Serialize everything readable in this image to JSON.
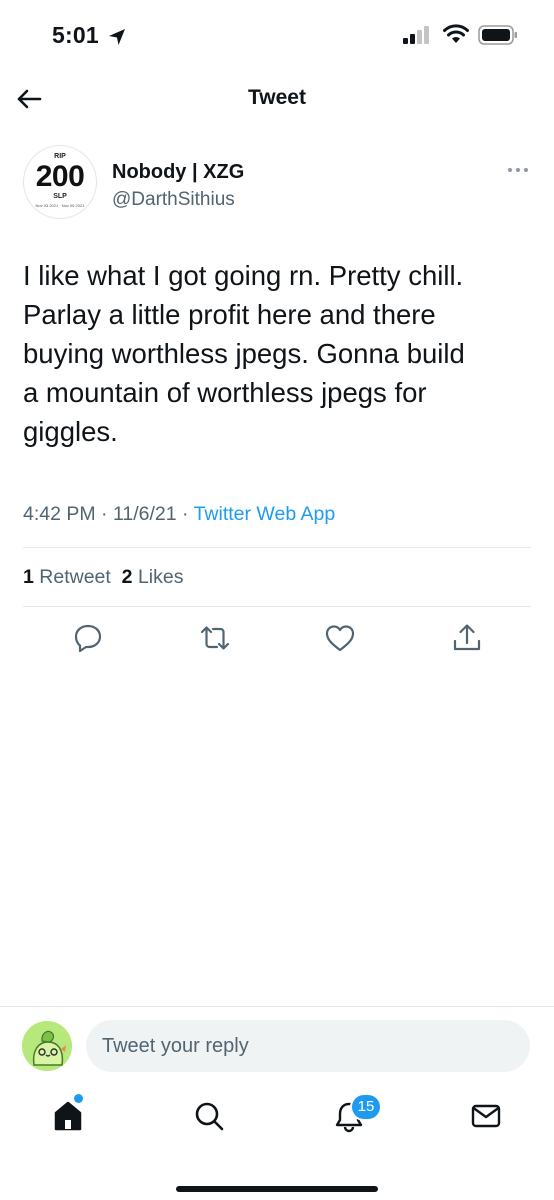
{
  "status_bar": {
    "time": "5:01",
    "location_icon": "location-arrow-icon",
    "signal_icon": "cellular-signal-icon",
    "wifi_icon": "wifi-icon",
    "battery_icon": "battery-icon"
  },
  "header": {
    "title": "Tweet",
    "back_icon": "back-arrow-icon"
  },
  "author": {
    "display_name": "Nobody | XZG",
    "handle": "@DarthSithius",
    "avatar": {
      "top_text": "RIP",
      "number": "200",
      "unit": "SLP",
      "dates": "Nov 03 2021 · Nov 06 2021"
    },
    "more_icon": "more-dots-icon"
  },
  "tweet": {
    "text": "I like what I got going rn. Pretty chill.\nParlay a little profit here and there\nbuying worthless jpegs. Gonna build\na mountain of worthless jpegs for\ngiggles.",
    "time": "4:42 PM",
    "date": "11/6/21",
    "separator": "·",
    "source": "Twitter Web App"
  },
  "engagement": {
    "retweet_count": "1",
    "retweet_label": "Retweet",
    "like_count": "2",
    "like_label": "Likes"
  },
  "actions": [
    "reply-icon",
    "retweet-icon",
    "like-icon",
    "share-icon"
  ],
  "reply": {
    "placeholder": "Tweet your reply"
  },
  "tab_bar": {
    "items": [
      "home-icon",
      "search-icon",
      "notifications-icon",
      "messages-icon"
    ],
    "notification_badge": "15"
  },
  "colors": {
    "accent": "#1d9bf0",
    "text": "#0f1419",
    "secondary": "#536471",
    "divider": "#e6e9ec"
  }
}
